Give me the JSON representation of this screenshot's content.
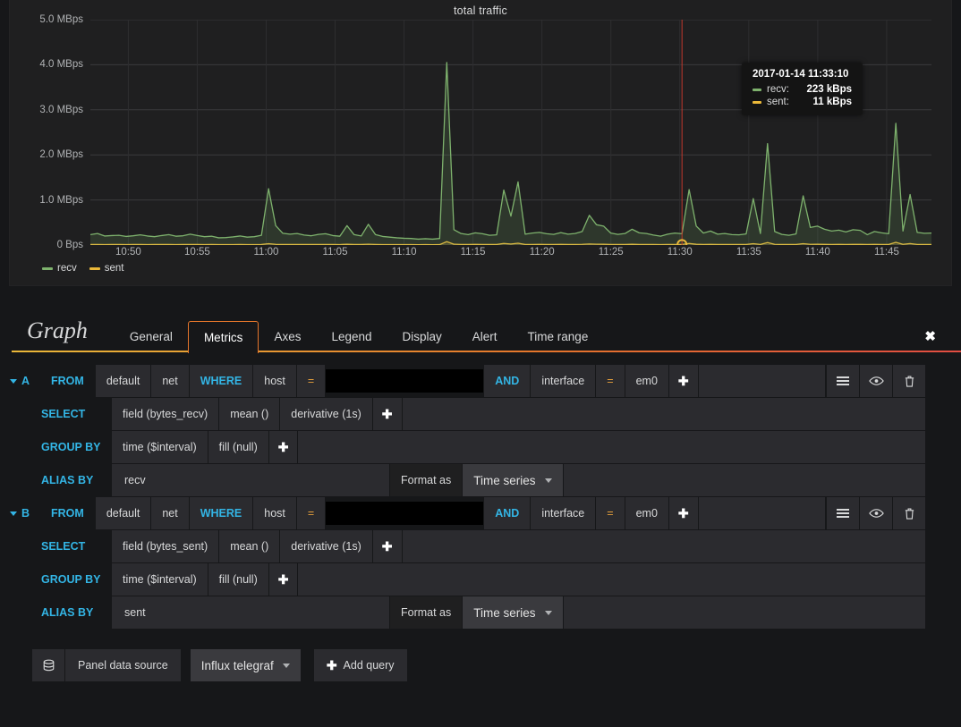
{
  "panel": {
    "title": "total traffic",
    "legend": [
      {
        "label": "recv",
        "color": "#7eb26d"
      },
      {
        "label": "sent",
        "color": "#eab839"
      }
    ],
    "tooltip": {
      "time": "2017-01-14 11:33:10",
      "rows": [
        {
          "name": "recv:",
          "value": "223 kBps",
          "color": "#7eb26d"
        },
        {
          "name": "sent:",
          "value": "11 kBps",
          "color": "#eab839"
        }
      ]
    }
  },
  "chart_data": {
    "type": "line",
    "title": "total traffic",
    "xlabel": "",
    "ylabel": "",
    "grid": true,
    "legend_position": "bottom-left",
    "ylim": [
      0,
      5000000
    ],
    "ytick_labels": [
      "0 Bps",
      "1.0 MBps",
      "2.0 MBps",
      "3.0 MBps",
      "4.0 MBps",
      "5.0 MBps"
    ],
    "ytick_values": [
      0,
      1000000,
      2000000,
      3000000,
      4000000,
      5000000
    ],
    "xtick_labels": [
      "10:50",
      "10:55",
      "11:00",
      "11:05",
      "11:10",
      "11:15",
      "11:20",
      "11:25",
      "11:30",
      "11:35",
      "11:40",
      "11:45"
    ],
    "x_range": [
      "10:48",
      "11:48"
    ],
    "cursor": {
      "time": "11:33:10",
      "x_label": "11:33"
    },
    "series": [
      {
        "name": "recv",
        "color": "#7eb26d",
        "unit": "Bps",
        "x": [
          0,
          1,
          2,
          3,
          4,
          5,
          6,
          7,
          8,
          9,
          10,
          11,
          12,
          13,
          14,
          15,
          16,
          17,
          18,
          19,
          20,
          21,
          22,
          23,
          24,
          25,
          26,
          27,
          28,
          29,
          30,
          31,
          32,
          33,
          34,
          35,
          36,
          37,
          38,
          39,
          40,
          41,
          42,
          43,
          44,
          45,
          46,
          47,
          48,
          49,
          50,
          51,
          52,
          53,
          54,
          55,
          56,
          57,
          58,
          59,
          60,
          61,
          62,
          63,
          64,
          65,
          66,
          67,
          68,
          69,
          70,
          71,
          72,
          73,
          74,
          75,
          76,
          77,
          78,
          79,
          80,
          81,
          82,
          83,
          84,
          85,
          86,
          87,
          88,
          89,
          90,
          91,
          92,
          93,
          94,
          95,
          96,
          97,
          98,
          99,
          100,
          101,
          102,
          103,
          104,
          105,
          106,
          107,
          108,
          109,
          110,
          111,
          112,
          113,
          114,
          115,
          116,
          117,
          118,
          119
        ],
        "values": [
          230000,
          255000,
          200000,
          210000,
          215000,
          190000,
          205000,
          225000,
          200000,
          185000,
          210000,
          230000,
          195000,
          205000,
          240000,
          210000,
          185000,
          195000,
          160000,
          165000,
          180000,
          200000,
          175000,
          185000,
          215000,
          1250000,
          430000,
          260000,
          240000,
          255000,
          220000,
          205000,
          235000,
          250000,
          210000,
          195000,
          430000,
          230000,
          200000,
          460000,
          230000,
          190000,
          175000,
          160000,
          150000,
          145000,
          130000,
          140000,
          130000,
          145000,
          4050000,
          340000,
          255000,
          230000,
          270000,
          250000,
          215000,
          225000,
          1220000,
          640000,
          1400000,
          240000,
          265000,
          280000,
          250000,
          235000,
          275000,
          240000,
          255000,
          300000,
          660000,
          450000,
          420000,
          265000,
          235000,
          255000,
          350000,
          270000,
          255000,
          220000,
          195000,
          240000,
          265000,
          250000,
          1230000,
          420000,
          265000,
          310000,
          240000,
          255000,
          230000,
          225000,
          245000,
          1030000,
          255000,
          2250000,
          300000,
          235000,
          215000,
          245000,
          1090000,
          390000,
          420000,
          350000,
          310000,
          330000,
          290000,
          340000,
          325000,
          230000,
          300000,
          270000,
          250000,
          2700000,
          310000,
          1120000,
          280000,
          260000,
          265000
        ]
      },
      {
        "name": "sent",
        "color": "#eab839",
        "unit": "Bps",
        "x": [
          0,
          1,
          2,
          3,
          4,
          5,
          6,
          7,
          8,
          9,
          10,
          11,
          12,
          13,
          14,
          15,
          16,
          17,
          18,
          19,
          20,
          21,
          22,
          23,
          24,
          25,
          26,
          27,
          28,
          29,
          30,
          31,
          32,
          33,
          34,
          35,
          36,
          37,
          38,
          39,
          40,
          41,
          42,
          43,
          44,
          45,
          46,
          47,
          48,
          49,
          50,
          51,
          52,
          53,
          54,
          55,
          56,
          57,
          58,
          59,
          60,
          61,
          62,
          63,
          64,
          65,
          66,
          67,
          68,
          69,
          70,
          71,
          72,
          73,
          74,
          75,
          76,
          77,
          78,
          79,
          80,
          81,
          82,
          83,
          84,
          85,
          86,
          87,
          88,
          89,
          90,
          91,
          92,
          93,
          94,
          95,
          96,
          97,
          98,
          99,
          100,
          101,
          102,
          103,
          104,
          105,
          106,
          107,
          108,
          109,
          110,
          111,
          112,
          113,
          114,
          115,
          116,
          117,
          118,
          119
        ],
        "values": [
          11000,
          12000,
          10000,
          11000,
          12000,
          10000,
          11000,
          12000,
          10000,
          11000,
          12000,
          11000,
          10000,
          11000,
          13000,
          12000,
          10000,
          11000,
          9000,
          9000,
          10000,
          11000,
          10000,
          10000,
          12000,
          30000,
          14000,
          12000,
          12000,
          13000,
          11000,
          11000,
          12000,
          13000,
          11000,
          10000,
          16000,
          12000,
          11000,
          17000,
          12000,
          10000,
          10000,
          9000,
          9000,
          9000,
          8000,
          9000,
          8000,
          9000,
          75000,
          18000,
          13000,
          12000,
          14000,
          13000,
          11000,
          12000,
          35000,
          22000,
          40000,
          12000,
          13000,
          14000,
          13000,
          12000,
          14000,
          12000,
          13000,
          15000,
          22000,
          17000,
          16000,
          13000,
          12000,
          13000,
          16000,
          13000,
          13000,
          11000,
          10000,
          12000,
          13000,
          13000,
          35000,
          16000,
          13000,
          15000,
          12000,
          13000,
          12000,
          11000,
          12000,
          29000,
          13000,
          55000,
          15000,
          12000,
          11000,
          12000,
          30000,
          15000,
          16000,
          14000,
          13000,
          14000,
          13000,
          14000,
          14000,
          12000,
          14000,
          13000,
          12000,
          60000,
          15000,
          32000,
          13000,
          12000,
          13000
        ]
      }
    ]
  },
  "editor": {
    "kind": "Graph",
    "close_icon": "✖",
    "tabs": [
      {
        "label": "General",
        "active": false
      },
      {
        "label": "Metrics",
        "active": true
      },
      {
        "label": "Axes",
        "active": false
      },
      {
        "label": "Legend",
        "active": false
      },
      {
        "label": "Display",
        "active": false
      },
      {
        "label": "Alert",
        "active": false
      },
      {
        "label": "Time range",
        "active": false
      }
    ],
    "row_actions": [
      {
        "name": "query-menu",
        "icon": "hamburger"
      },
      {
        "name": "toggle-visibility",
        "icon": "eye"
      },
      {
        "name": "remove-query",
        "icon": "trash"
      }
    ],
    "labels": {
      "from": "FROM",
      "where": "WHERE",
      "and": "AND",
      "select": "SELECT",
      "group_by": "GROUP BY",
      "alias_by": "ALIAS BY",
      "format_as": "Format as",
      "plus": "✚"
    },
    "queries": [
      {
        "refId": "A",
        "policy": "default",
        "measurement": "net",
        "where_key": "host",
        "where_op": "=",
        "where_value": "",
        "where_value_redacted": true,
        "and_key": "interface",
        "and_op": "=",
        "and_value": "em0",
        "select": [
          "field (bytes_recv)",
          "mean ()",
          "derivative (1s)"
        ],
        "group_by": [
          "time ($interval)",
          "fill (null)"
        ],
        "alias": "recv",
        "format_as": "Time series"
      },
      {
        "refId": "B",
        "policy": "default",
        "measurement": "net",
        "where_key": "host",
        "where_op": "=",
        "where_value": "",
        "where_value_redacted": true,
        "and_key": "interface",
        "and_op": "=",
        "and_value": "em0",
        "select": [
          "field (bytes_sent)",
          "mean ()",
          "derivative (1s)"
        ],
        "group_by": [
          "time ($interval)",
          "fill (null)"
        ],
        "alias": "sent",
        "format_as": "Time series"
      }
    ],
    "bottom": {
      "datasource_icon": "database-icon",
      "datasource_label": "Panel data source",
      "datasource_value": "Influx telegraf",
      "add_query_label": "Add query"
    }
  }
}
